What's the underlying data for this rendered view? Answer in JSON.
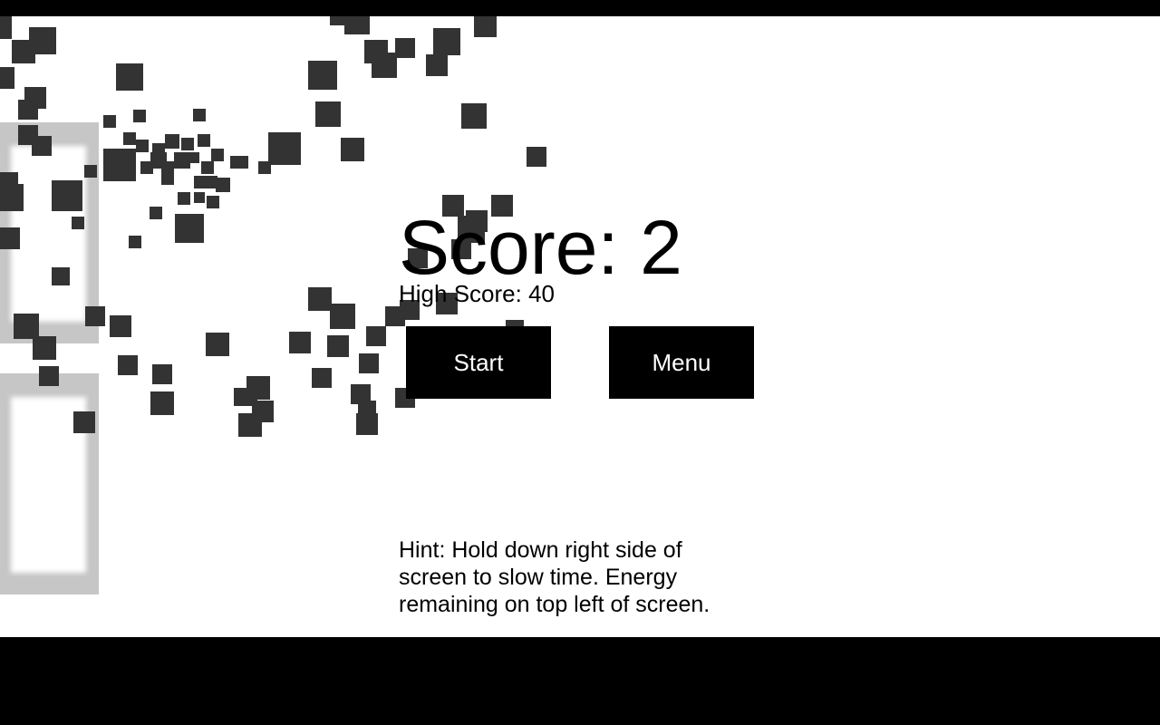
{
  "score": {
    "label": "Score: 2"
  },
  "high_score": {
    "label": "High Score: 40"
  },
  "buttons": {
    "start": "Start",
    "menu": "Menu"
  },
  "hint": "Hint: Hold down right side of screen to slow time. Energy remaining on top left of screen.",
  "colors": {
    "background": "#ffffff",
    "letterbox": "#000000",
    "block": "#333333",
    "pillar": "#c6c6c6",
    "button": "#000000"
  }
}
